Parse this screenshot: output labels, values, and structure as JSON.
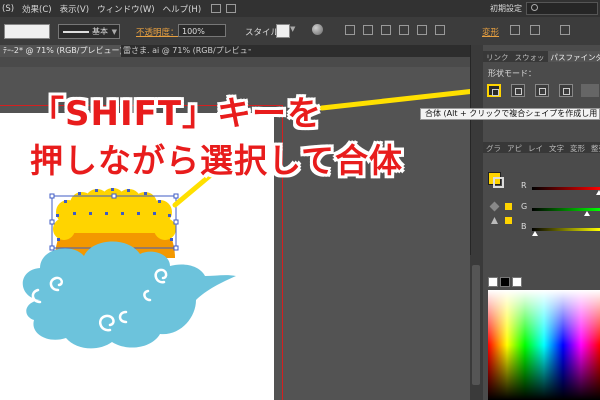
{
  "menubar": {
    "items": [
      "(S)",
      "効果(C)",
      "表示(V)",
      "ウィンドウ(W)",
      "ヘルプ(H)"
    ],
    "workspace": "初期設定"
  },
  "controlbar": {
    "stroke_weight": "基本",
    "opacity_label": "不透明度：",
    "opacity_value": "100%",
    "style_label": "スタイル：",
    "transform_label": "変形"
  },
  "document_tabs": [
    {
      "label": "ﾃｰ-2* @ 71% (RGB/プレビュー)",
      "active": true
    },
    {
      "label": "雷さま. ai @ 71% (RGB/プレビュー)",
      "active": false
    }
  ],
  "panel": {
    "tabs": [
      "リンク",
      "スウォッ",
      "パスファインダー"
    ],
    "shape_mode_label": "形状モード：",
    "tooltip": "合体 (Alt + クリックで複合シェイプを作成し用",
    "sub_tabs": [
      "グラ",
      "アピ",
      "レイ",
      "文字",
      "変形",
      "整列",
      "カ"
    ],
    "color_labels": [
      "R",
      "G",
      "B"
    ]
  },
  "annotation": {
    "line1": "「SHIFT」キーを",
    "line2": "押しながら選択して合体"
  },
  "colors": {
    "highlight": "#FFD400",
    "headline": "#E81C1C",
    "cloud": "#6CC3DC",
    "sun": "#F39800",
    "bumps": "#FFD400",
    "selection": "#3F5BC4"
  }
}
